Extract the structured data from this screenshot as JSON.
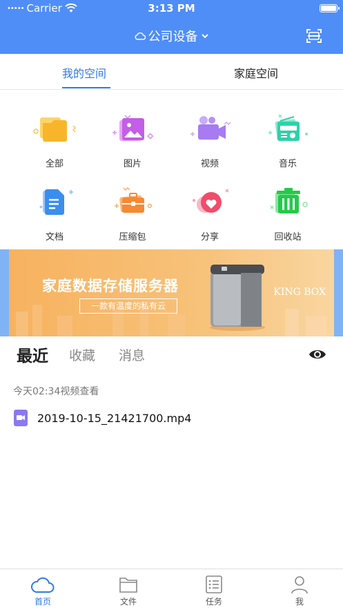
{
  "status_bar": {
    "carrier": "Carrier",
    "time": "3:13 PM"
  },
  "nav": {
    "title": "公司设备",
    "scan_icon": "scan-icon"
  },
  "space_tabs": [
    {
      "label": "我的空间",
      "active": true
    },
    {
      "label": "家庭空间",
      "active": false
    }
  ],
  "categories": [
    {
      "label": "全部",
      "icon": "folder-icon",
      "color": "#f9b52a"
    },
    {
      "label": "图片",
      "icon": "image-icon",
      "color": "#c45de8"
    },
    {
      "label": "视频",
      "icon": "video-icon",
      "color": "#a77bf1"
    },
    {
      "label": "音乐",
      "icon": "radio-icon",
      "color": "#2fd1a8"
    },
    {
      "label": "文档",
      "icon": "document-icon",
      "color": "#3a8ef0"
    },
    {
      "label": "压缩包",
      "icon": "briefcase-icon",
      "color": "#f58a32"
    },
    {
      "label": "分享",
      "icon": "heart-icon",
      "color": "#f04d6b"
    },
    {
      "label": "回收站",
      "icon": "trash-icon",
      "color": "#25c94a"
    }
  ],
  "banner": {
    "title": "家庭数据存储服务器",
    "subtitle": "一款有温度的私有云",
    "brand": "KING BOX"
  },
  "recent_tabs": [
    {
      "label": "最近",
      "active": true
    },
    {
      "label": "收藏",
      "active": false
    },
    {
      "label": "消息",
      "active": false
    }
  ],
  "recent": {
    "time_label": "今天02:34视频查看",
    "files": [
      {
        "name": "2019-10-15_21421700.mp4",
        "icon": "video-file-icon"
      }
    ]
  },
  "tabbar": [
    {
      "label": "首页",
      "icon": "cloud-icon",
      "active": true
    },
    {
      "label": "文件",
      "icon": "folder-outline-icon",
      "active": false
    },
    {
      "label": "任务",
      "icon": "task-list-icon",
      "active": false
    },
    {
      "label": "我",
      "icon": "user-icon",
      "active": false
    }
  ],
  "colors": {
    "header": "#4f8ef7",
    "accent": "#2e7ae6"
  }
}
